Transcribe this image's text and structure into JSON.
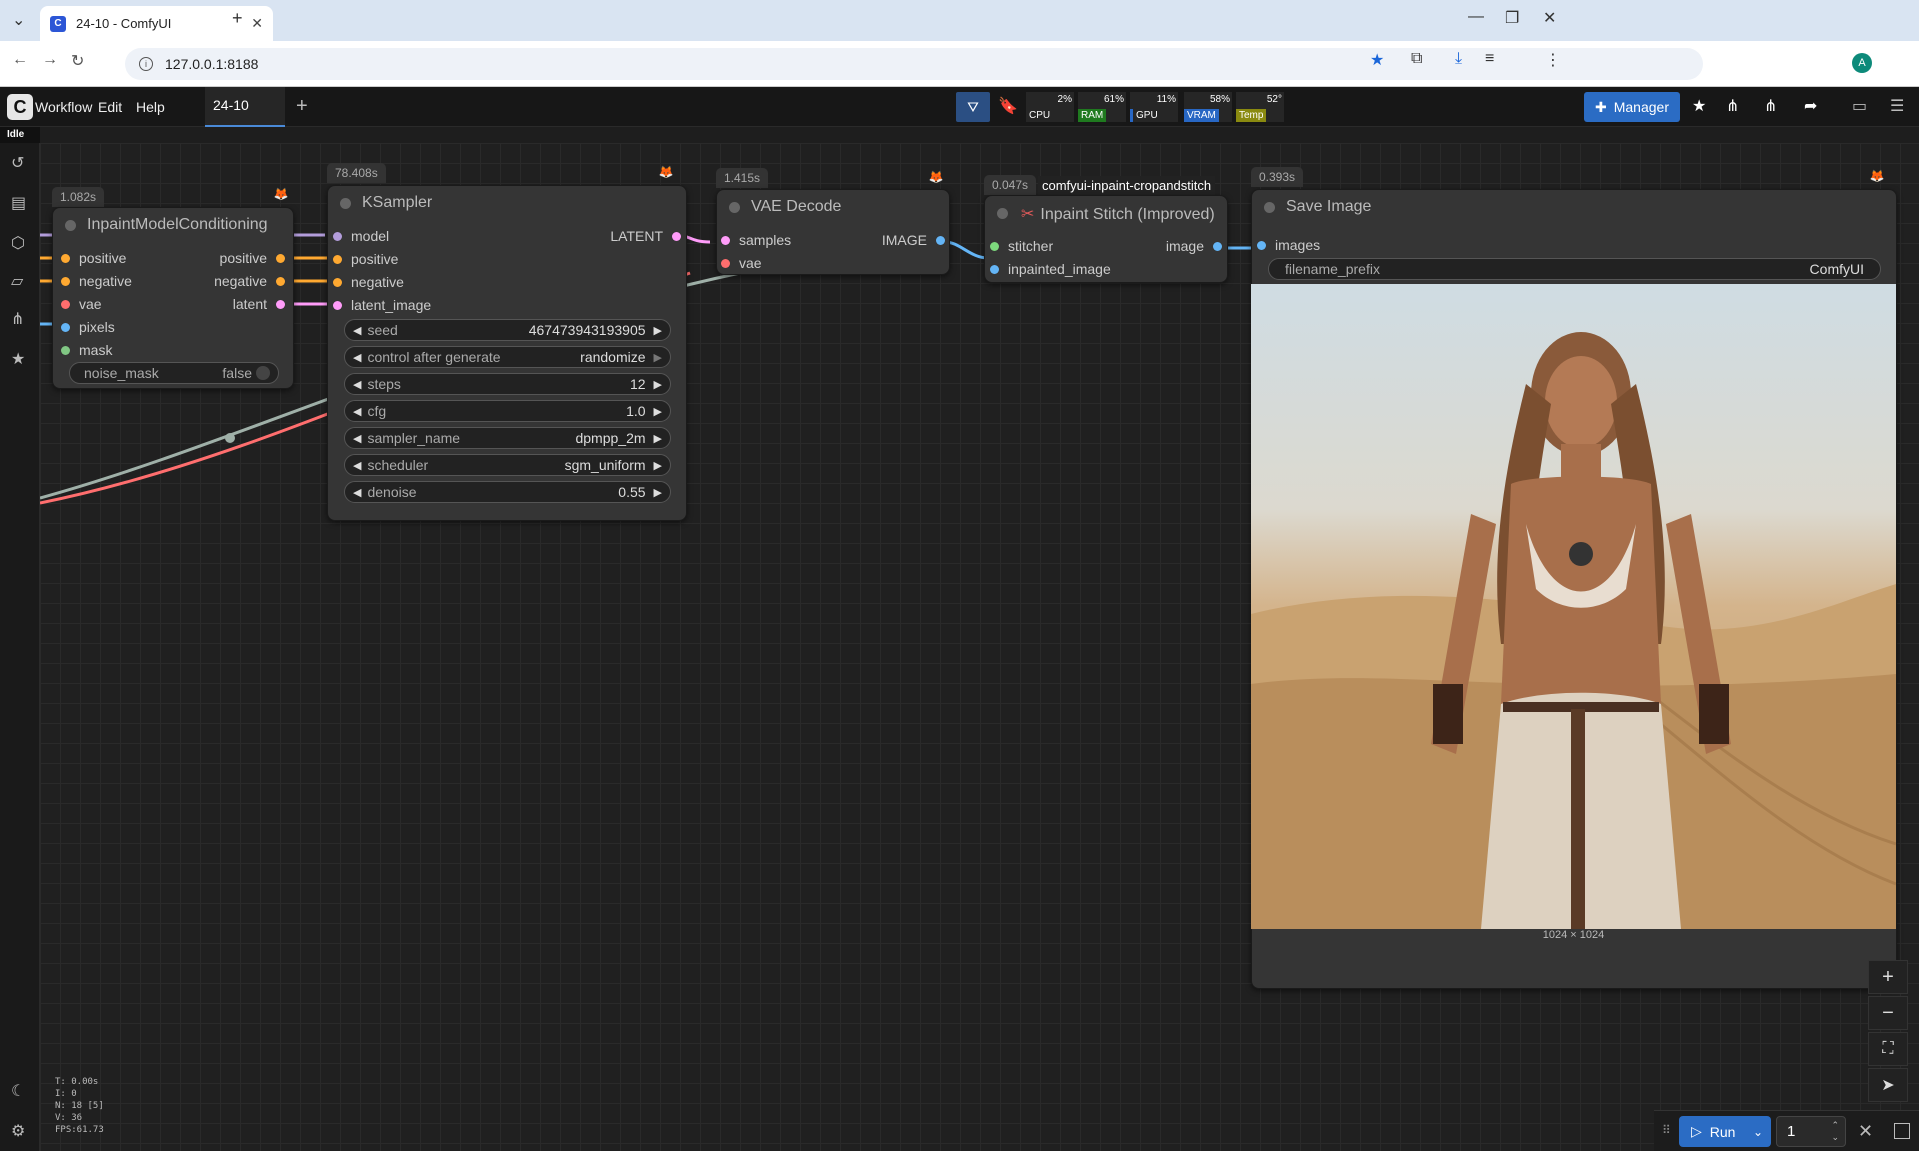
{
  "browser": {
    "tab_title": "24-10 - ComfyUI",
    "url": "127.0.0.1:8188"
  },
  "menu": {
    "workflow": "Workflow",
    "edit": "Edit",
    "help": "Help",
    "open_tab": "24-10",
    "status": "Idle",
    "manager": "Manager"
  },
  "monitor": {
    "cpu": {
      "label": "CPU",
      "pct": "2%"
    },
    "ram": {
      "label": "RAM",
      "pct": "61%"
    },
    "gpu": {
      "label": "GPU",
      "pct": "11%"
    },
    "vram": {
      "label": "VRAM",
      "pct": "58%"
    },
    "temp": {
      "label": "Temp",
      "pct": "52°"
    }
  },
  "colors": {
    "accent": "#2b6cc4",
    "ram": "#1f7a1f",
    "vram": "#2867c4",
    "temp": "#8a8a10",
    "wire_conditioning": "#ffa931",
    "wire_latent": "#ff9cf9",
    "wire_vae": "#ff6e6e",
    "wire_image": "#64b5f6",
    "wire_model": "#b39ddb"
  },
  "nodes": {
    "inpaint_cond": {
      "time": "1.082s",
      "title": "InpaintModelConditioning",
      "inputs": [
        "positive",
        "negative",
        "vae",
        "pixels",
        "mask"
      ],
      "outputs": [
        "positive",
        "negative",
        "latent"
      ],
      "widget": {
        "name": "noise_mask",
        "value": "false"
      }
    },
    "ksampler": {
      "time": "78.408s",
      "title": "KSampler",
      "inputs": [
        "model",
        "positive",
        "negative",
        "latent_image"
      ],
      "output": "LATENT",
      "widgets": [
        {
          "name": "seed",
          "value": "467473943193905"
        },
        {
          "name": "control after generate",
          "value": "randomize"
        },
        {
          "name": "steps",
          "value": "12"
        },
        {
          "name": "cfg",
          "value": "1.0"
        },
        {
          "name": "sampler_name",
          "value": "dpmpp_2m"
        },
        {
          "name": "scheduler",
          "value": "sgm_uniform"
        },
        {
          "name": "denoise",
          "value": "0.55"
        }
      ]
    },
    "vae_decode": {
      "time": "1.415s",
      "title": "VAE Decode",
      "inputs": [
        "samples",
        "vae"
      ],
      "output": "IMAGE"
    },
    "inpaint_stitch": {
      "time": "0.047s",
      "group": "comfyui-inpaint-cropandstitch",
      "title": "Inpaint Stitch (Improved)",
      "inputs": [
        "stitcher",
        "inpainted_image"
      ],
      "output": "image"
    },
    "save_image": {
      "time": "0.393s",
      "title": "Save Image",
      "input": "images",
      "widget": {
        "name": "filename_prefix",
        "value": "ComfyUI"
      },
      "resolution": "1024 × 1024"
    }
  },
  "stats": {
    "t": "T: 0.00s",
    "i": "I: 0",
    "n": "N: 18 [5]",
    "v": "V: 36",
    "fps": "FPS:61.73"
  },
  "run": {
    "label": "Run",
    "count": "1"
  }
}
